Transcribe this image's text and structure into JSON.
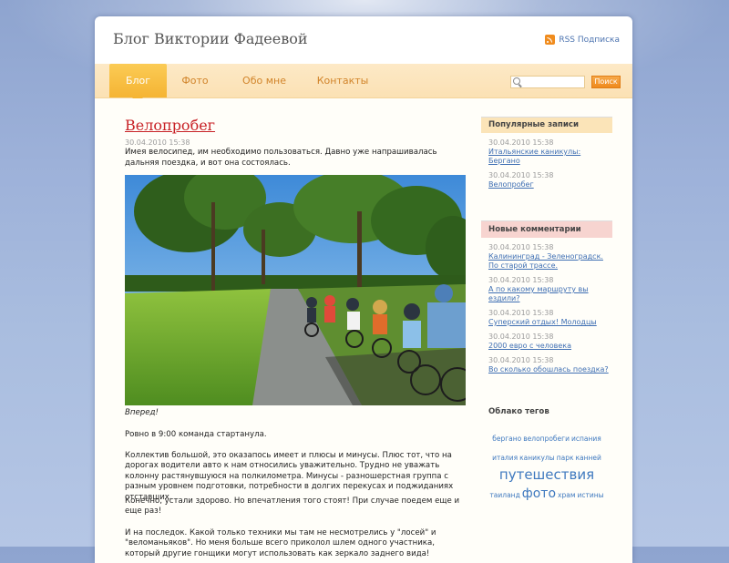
{
  "site_title": "Блог Виктории Фадеевой",
  "rss_label": "RSS Подписка",
  "nav": [
    {
      "label": "Блог",
      "active": true
    },
    {
      "label": "Фото",
      "active": false
    },
    {
      "label": "Обо мне",
      "active": false
    },
    {
      "label": "Контакты",
      "active": false
    }
  ],
  "search": {
    "placeholder": "",
    "button_label": "Поиск"
  },
  "post": {
    "title": "Велопробег",
    "date": "30.04.2010 15:38",
    "intro": "Имея велосипед, им необходимо пользоваться. Давно уже напрашивалась дальняя поездка, и вот она состоялась.",
    "photo_caption": "Вперед!",
    "paragraphs": [
      "Ровно в 9:00 команда стартанула.",
      "Коллектив большой, это оказапось имеет и плюсы и минусы. Плюс тот, что на дорогах водители авто к нам относились уважительно. Трудно не уважать колонну растянувшуюся на полкилометра. Минусы - разношерстная группа с разным уровнем подготовки, потребности в долгих перекусах и поджиданиях отставших.",
      "Конечно, устали здорово. Но впечатления того стоят! При случае поедем еще и еще раз!",
      "И на последок. Какой только техники мы там не несмотрелись у \"лосей\" и \"веломаньяков\". Но меня больше всего приколол шлем одного участника, который другие гонщики могут использовать как зеркало заднего вида!"
    ]
  },
  "sidebar": {
    "popular": {
      "heading": "Популярные записи",
      "items": [
        {
          "date": "30.04.2010 15:38",
          "link": "Итальянские каникулы: Бергано"
        },
        {
          "date": "30.04.2010 15:38",
          "link": "Велопробег"
        }
      ]
    },
    "comments": {
      "heading": "Новые комментарии",
      "items": [
        {
          "date": "30.04.2010 15:38",
          "link": "Калининград - Зеленоградск. По старой трассе."
        },
        {
          "date": "30.04.2010 15:38",
          "link": "А по какому маршруту вы ездили?"
        },
        {
          "date": "30.04.2010 15:38",
          "link": "Суперский отдых! Молодцы"
        },
        {
          "date": "30.04.2010 15:38",
          "link": "2000 евро с человека"
        },
        {
          "date": "30.04.2010 15:38",
          "link": "Во сколько обошлась поездка?"
        }
      ]
    },
    "tags": {
      "heading": "Облако тегов",
      "items": [
        {
          "label": "бергано"
        },
        {
          "label": "велопробеги"
        },
        {
          "label": "испания"
        },
        {
          "label": "италия"
        },
        {
          "label": "каникулы"
        },
        {
          "label": "парк"
        },
        {
          "label": "канней"
        },
        {
          "label": "путешествия"
        },
        {
          "label": "таиланд"
        },
        {
          "label": "фото"
        },
        {
          "label": "храм"
        },
        {
          "label": "истины"
        }
      ]
    }
  },
  "colors": {
    "accent_orange": "#f5b433",
    "title_red": "#c82227",
    "link_blue": "#3f6fb3"
  }
}
